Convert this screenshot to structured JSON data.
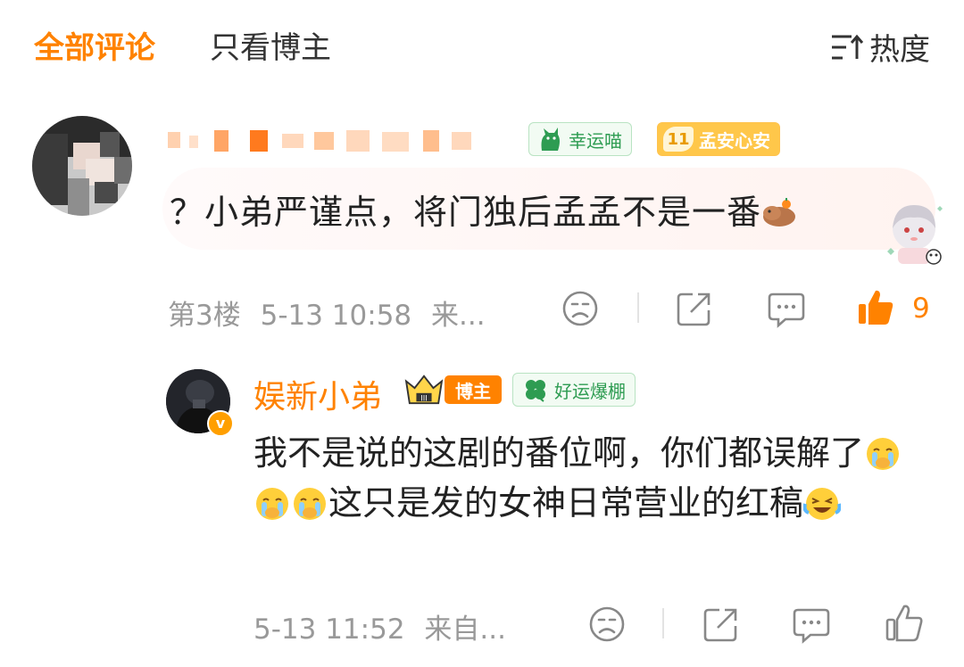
{
  "tabs": {
    "all_comments": "全部评论",
    "author_only": "只看博主",
    "sort_label": "热度"
  },
  "comment1": {
    "badge_cat": "幸运喵",
    "badge_fan_level": "11",
    "badge_fan_name": "孟安心安",
    "text": "？小弟严谨点，将门独后孟孟不是一番",
    "floor": "第3楼",
    "time": "5-13 10:58",
    "source": "来...",
    "like_count": "9"
  },
  "reply": {
    "name": "娱新小弟",
    "tag_author": "博主",
    "badge_luck": "好运爆棚",
    "text_part1": "我不是说的这剧的番位啊，你们都误解了",
    "text_part2": "这只是发的女神日常营业的红稿",
    "time": "5-13 11:52",
    "source": "来自...",
    "verified_mark": "v"
  },
  "colors": {
    "accent": "#ff8200",
    "meta_gray": "#999999",
    "badge_green": "#2e9c52"
  },
  "icons": [
    "sort-icon",
    "dislike-icon",
    "share-icon",
    "comment-icon",
    "like-icon",
    "cat-icon",
    "crown-icon",
    "clover-icon",
    "cry-emoji-icon",
    "laugh-cry-emoji-icon"
  ]
}
